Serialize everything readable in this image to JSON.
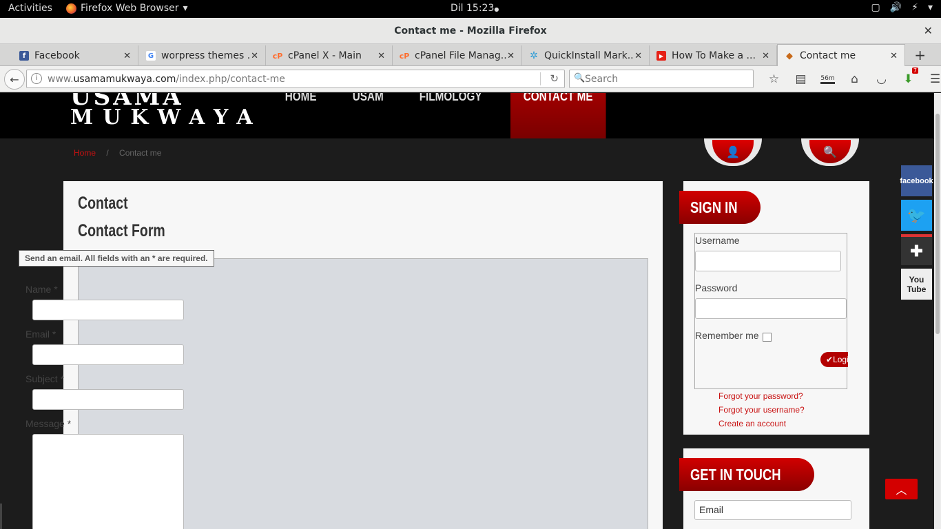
{
  "gnome": {
    "activities": "Activities",
    "app_name": "Firefox Web Browser",
    "app_arrow": "▾",
    "clock": "Dil 15:23",
    "clock_dot": "●"
  },
  "window": {
    "title": "Contact me - Mozilla Firefox",
    "close": "✕"
  },
  "tabs": [
    {
      "label": "Facebook",
      "icon": "facebook-icon",
      "color": "#3b5998",
      "glyph": "f"
    },
    {
      "label": "worpress themes ...",
      "icon": "google-icon",
      "color": "#4285f4",
      "glyph": "G"
    },
    {
      "label": "cPanel X - Main",
      "icon": "cpanel-icon",
      "color": "#ff6c2c",
      "glyph": "cP"
    },
    {
      "label": "cPanel File Manag...",
      "icon": "cpanel-icon",
      "color": "#ff6c2c",
      "glyph": "cP"
    },
    {
      "label": "QuickInstall Mark...",
      "icon": "quickinstall-icon",
      "color": "#2a9bd6",
      "glyph": "✲"
    },
    {
      "label": "How To Make a ...",
      "icon": "youtube-icon",
      "color": "#e62117",
      "glyph": "▶"
    },
    {
      "label": "Contact me",
      "icon": "site-icon",
      "color": "#c86a1a",
      "glyph": "◆"
    }
  ],
  "tab_close": "✕",
  "new_tab": "+",
  "nav": {
    "url_host": "usamamukwaya.com",
    "url_prefix": "www.",
    "url_path": "/index.php/contact-me",
    "search_placeholder": "Search",
    "timer_badge": "56m",
    "addon_badge": "7"
  },
  "site": {
    "logo_top": "USAMA",
    "logo_bottom": "MUKWAYA",
    "menu": [
      "HOME",
      "USAM",
      "FILMOLOGY",
      "CONTACT ME"
    ],
    "breadcrumb_home": "Home",
    "breadcrumb_sep": "/",
    "breadcrumb_current": "Contact me"
  },
  "contact": {
    "heading": "Contact",
    "form_heading": "Contact Form",
    "legend": "Send an email. All fields with an * are required.",
    "name_label": "Name *",
    "email_label": "Email *",
    "subject_label": "Subject *",
    "message_label": "Message *"
  },
  "signin": {
    "title": "SIGN IN",
    "username_label": "Username",
    "password_label": "Password",
    "remember_label": "Remember me",
    "login_button": "Login",
    "forgot_password": "Forgot your password?",
    "forgot_username": "Forgot your username?",
    "create_account": "Create an account"
  },
  "touch": {
    "title": "GET IN TOUCH",
    "email_placeholder": "Email"
  },
  "social": [
    {
      "name": "facebook",
      "label": "facebook",
      "color": "#3b5998"
    },
    {
      "name": "twitter",
      "label": "🐦",
      "color": "#1da1f2"
    },
    {
      "name": "google-plus",
      "label": "✚",
      "color": "#333333"
    },
    {
      "name": "youtube",
      "label": "You Tube",
      "color": "#eeeeee"
    }
  ],
  "colors": {
    "accent_red": "#c81111",
    "header_black": "#000000"
  }
}
